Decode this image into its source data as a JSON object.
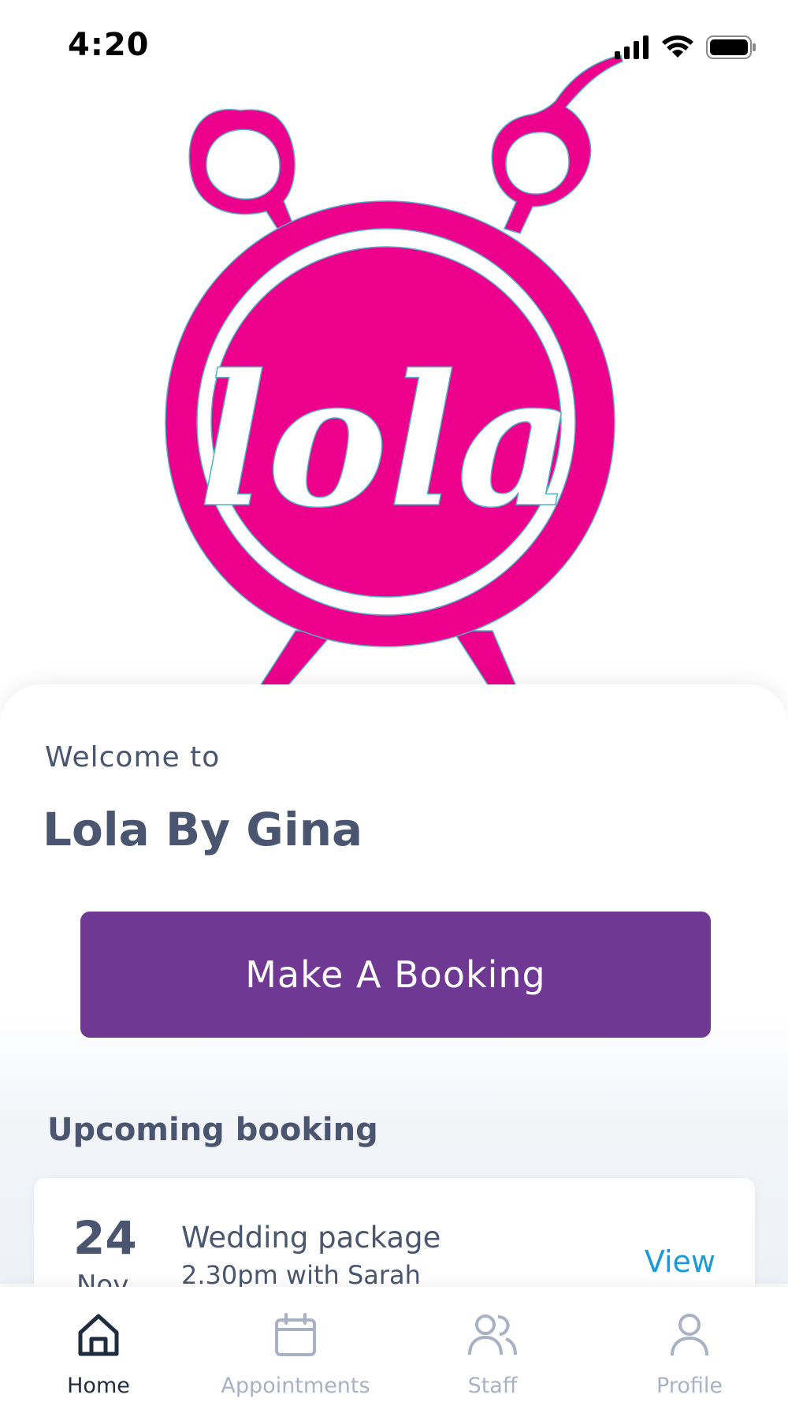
{
  "status_bar": {
    "time": "4:20",
    "icons": [
      "cellular-signal-icon",
      "wifi-icon",
      "battery-icon"
    ]
  },
  "hero": {
    "logo_text": "lola",
    "logo_color": "#ec008c"
  },
  "welcome": {
    "subtitle": "Welcome to",
    "title": "Lola By Gina"
  },
  "booking_button": {
    "label": "Make A Booking",
    "color": "#6e3893"
  },
  "upcoming": {
    "section_title": "Upcoming booking",
    "card": {
      "day": "24",
      "month": "Nov",
      "service": "Wedding package",
      "detail": "2.30pm with Sarah",
      "action": "View"
    }
  },
  "tab_bar": {
    "tabs": [
      {
        "label": "Home",
        "icon": "home-icon",
        "active": true
      },
      {
        "label": "Appointments",
        "icon": "calendar-icon",
        "active": false
      },
      {
        "label": "Staff",
        "icon": "people-icon",
        "active": false
      },
      {
        "label": "Profile",
        "icon": "user-icon",
        "active": false
      }
    ]
  },
  "colors": {
    "text": "#4a5670",
    "link": "#1a9ad6",
    "tab_inactive": "#a9b1c4",
    "tab_active": "#1f2b3e"
  }
}
